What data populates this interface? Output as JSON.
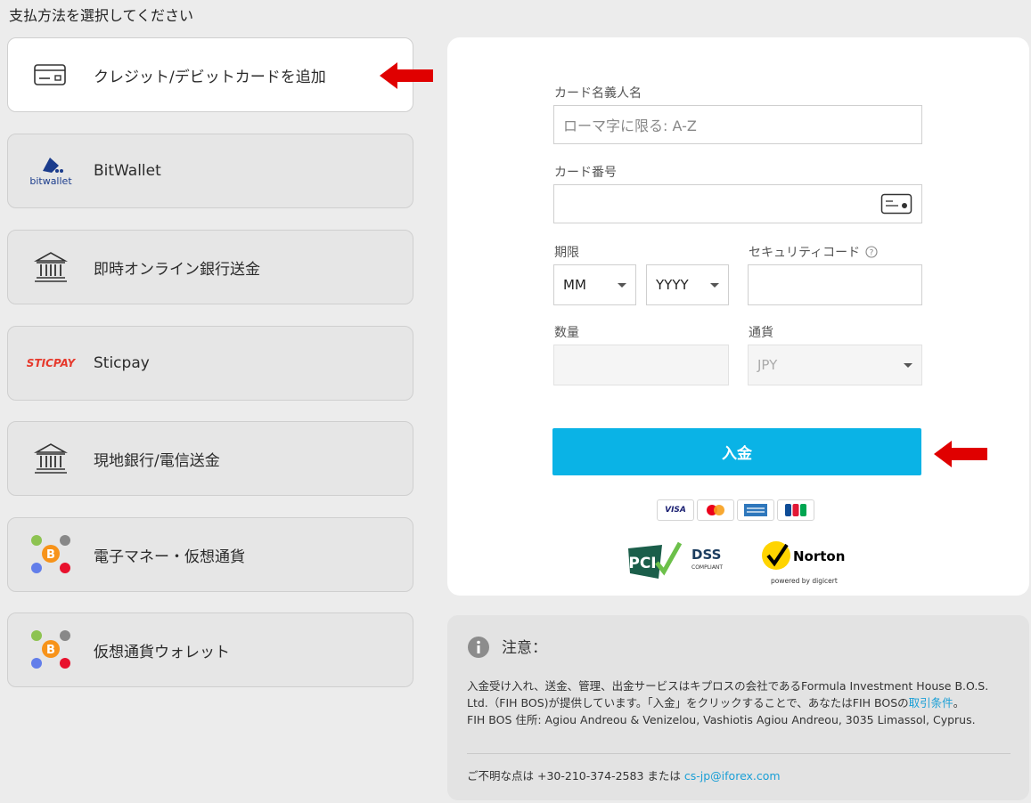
{
  "page": {
    "title": "支払方法を選択してください"
  },
  "methods": [
    {
      "label": "クレジット/デビットカードを追加",
      "icon": "credit-card-icon",
      "active": true
    },
    {
      "label": "BitWallet",
      "logo_text": "bitwallet",
      "icon": "bitwallet-logo-icon"
    },
    {
      "label": "即時オンライン銀行送金",
      "icon": "bank-icon"
    },
    {
      "label": "Sticpay",
      "logo_text": "STICPAY",
      "icon": "sticpay-logo-icon"
    },
    {
      "label": "現地銀行/電信送金",
      "icon": "bank-icon"
    },
    {
      "label": "電子マネー・仮想通貨",
      "icon": "crypto-coins-icon"
    },
    {
      "label": "仮想通貨ウォレット",
      "icon": "crypto-coins-icon"
    }
  ],
  "form": {
    "cardholder_label": "カード名義人名",
    "cardholder_placeholder": "ローマ字に限る: A-Z",
    "card_number_label": "カード番号",
    "card_number_value": "",
    "expiry_label": "期限",
    "month_value": "MM",
    "year_value": "YYYY",
    "security_label": "セキュリティコード",
    "security_help_icon": "question-circle-icon",
    "security_value": "",
    "amount_label": "数量",
    "amount_value": "",
    "currency_label": "通貨",
    "currency_value": "JPY",
    "submit_label": "入金"
  },
  "card_brands": [
    {
      "name": "VISA",
      "icon": "visa-logo-icon"
    },
    {
      "name": "Mastercard",
      "icon": "mastercard-logo-icon"
    },
    {
      "name": "American Express",
      "icon": "amex-logo-icon"
    },
    {
      "name": "JCB",
      "icon": "jcb-logo-icon"
    }
  ],
  "security_badges": {
    "pci_text": "DSS",
    "pci_sub": "COMPLIANT",
    "norton_text": "Norton",
    "norton_sub": "powered by digicert"
  },
  "notice": {
    "title": "注意：",
    "line1": "入金受け入れ、送金、管理、出金サービスはキプロスの会社であるFormula Investment House B.O.S. Ltd.（FIH BOS)が提供しています。「入金」をクリックすることで、あなたはFIH BOSの",
    "terms_link": "取引条件",
    "line1_end": "。",
    "address": "FIH BOS 住所: Agiou Andreou & Venizelou, Vashiotis Agiou Andreou, 3035 Limassol, Cyprus.",
    "contact_prefix": "ご不明な点は +30-210-374-2583 または ",
    "contact_email": "cs-jp@iforex.com"
  },
  "colors": {
    "accent": "#0ab3e6",
    "arrow": "#e00000",
    "link": "#1a9fd6"
  }
}
